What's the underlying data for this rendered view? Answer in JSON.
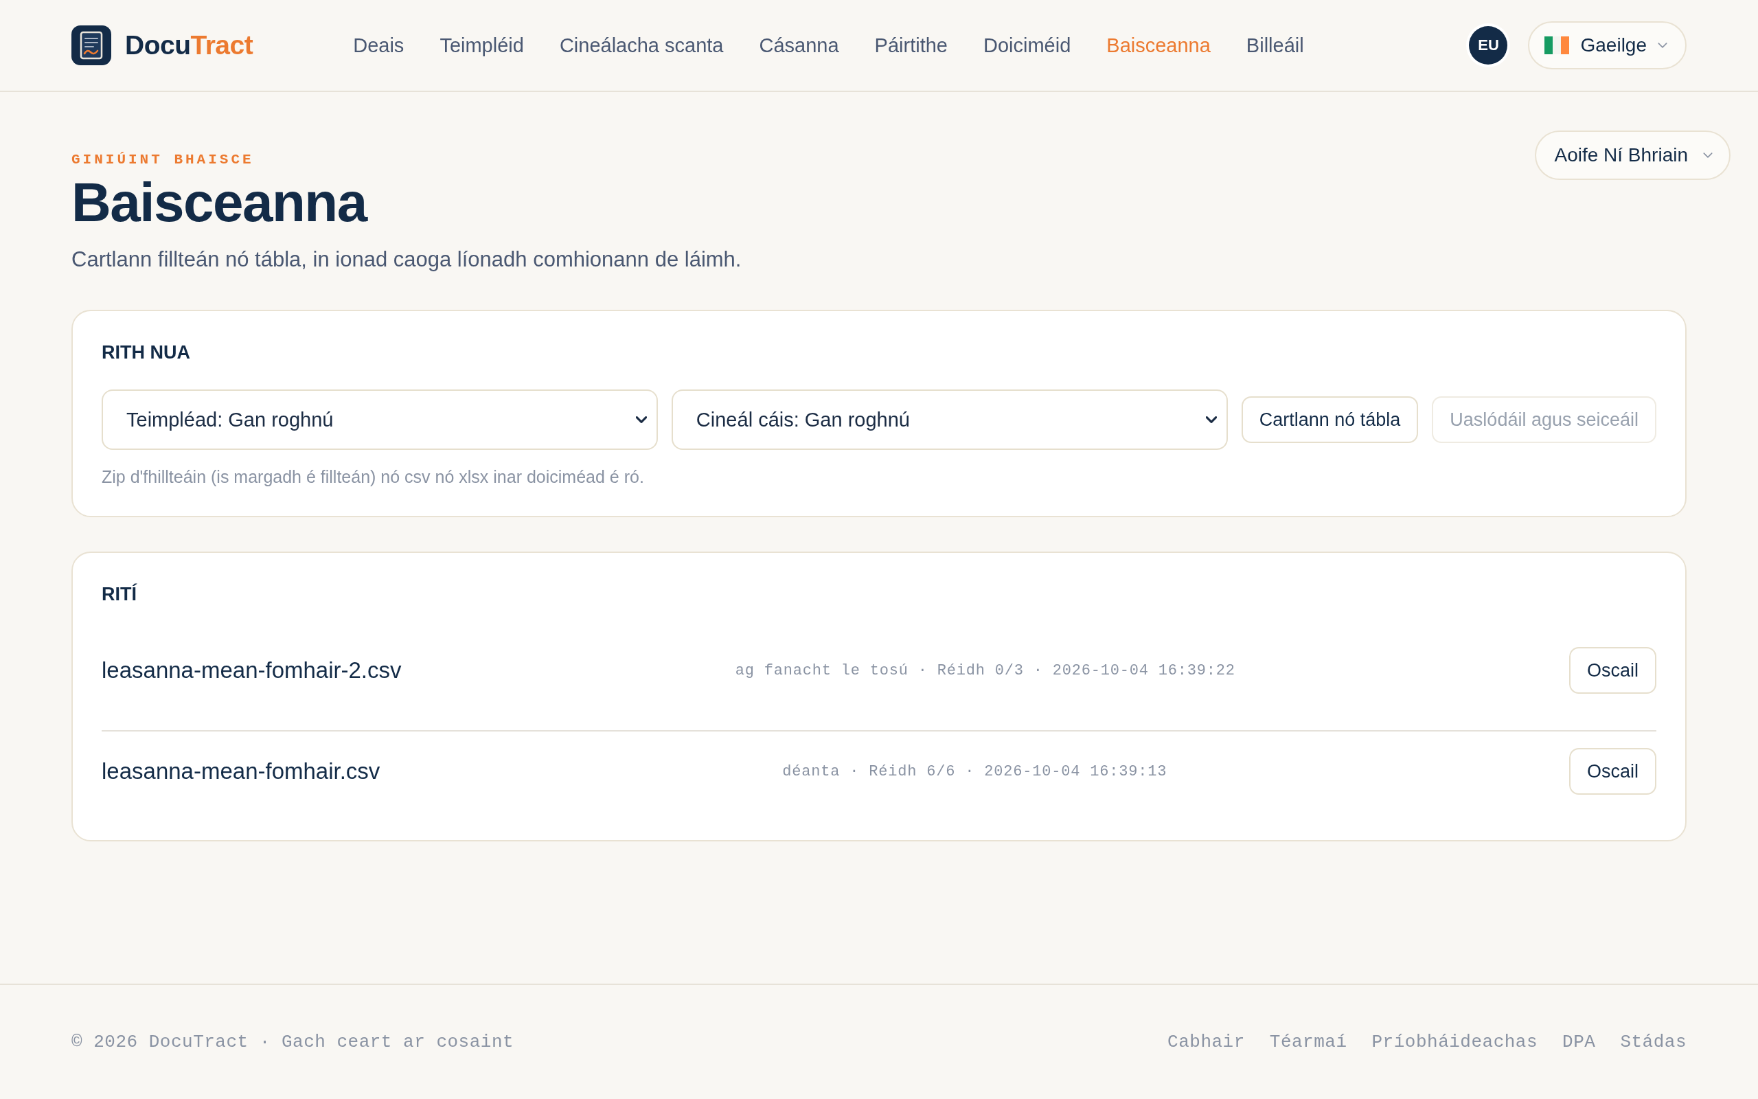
{
  "header": {
    "logo": {
      "prefix": "Docu",
      "suffix": "Tract"
    },
    "nav": [
      {
        "label": "Deais",
        "selected": false
      },
      {
        "label": "Teimpléid",
        "selected": false
      },
      {
        "label": "Cineálacha scanta",
        "selected": false
      },
      {
        "label": "Cásanna",
        "selected": false
      },
      {
        "label": "Páirtithe",
        "selected": false
      },
      {
        "label": "Doiciméid",
        "selected": false
      },
      {
        "label": "Baisceanna",
        "selected": true
      },
      {
        "label": "Billeáil",
        "selected": false
      }
    ],
    "region_badge": "EU",
    "language": {
      "label": "Gaeilge"
    }
  },
  "user_menu": {
    "name": "Aoife Ní Bhriain"
  },
  "page": {
    "eyebrow": "GINIÚINT BHAISCE",
    "title": "Baisceanna",
    "subtitle": "Cartlann fillteán nó tábla, in ionad caoga líonadh comhionann de láimh."
  },
  "new_run": {
    "heading": "RITH NUA",
    "selects": [
      {
        "value": "Teimpléad: Gan roghnú"
      },
      {
        "value": "Cineál cáis: Gan roghnú"
      }
    ],
    "buttons": [
      {
        "label": "Cartlann nó tábla",
        "disabled": false
      },
      {
        "label": "Uaslódáil agus seiceáil",
        "disabled": true
      }
    ],
    "hint": "Zip d'fhillteáin (is margadh é fillteán) nó csv nó xlsx inar doiciméad é ró."
  },
  "runs": {
    "heading": "RITÍ",
    "rows": [
      {
        "filename": "leasanna-mean-fomhair-2.csv",
        "meta": "ag fanacht le tosú · Réidh 0/3 · 2026-10-04 16:39:22",
        "action": "Oscail"
      },
      {
        "filename": "leasanna-mean-fomhair.csv",
        "meta": "déanta · Réidh 6/6 · 2026-10-04 16:39:13",
        "action": "Oscail"
      }
    ]
  },
  "footer": {
    "copyright": "© 2026 DocuTract · Gach ceart ar cosaint",
    "links": [
      "Cabhair",
      "Téarmaí",
      "Príobháideachas",
      "DPA",
      "Stádas"
    ]
  }
}
